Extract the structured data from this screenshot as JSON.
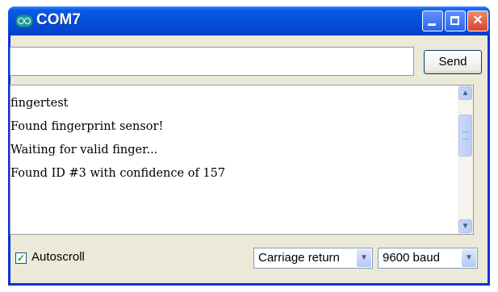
{
  "window": {
    "title": "COM7"
  },
  "icons": {
    "app": "arduino-icon",
    "minimize": "minimize-icon",
    "maximize": "maximize-icon",
    "close": "close-icon"
  },
  "input": {
    "value": "",
    "placeholder": ""
  },
  "send_label": "Send",
  "output_lines": [
    "fingertest",
    "Found fingerprint sensor!",
    "Waiting for valid finger...",
    "Found ID #3 with confidence of 157"
  ],
  "footer": {
    "autoscroll_label": "Autoscroll",
    "autoscroll_checked": true,
    "line_ending": "Carriage return",
    "baud_rate": "9600 baud"
  },
  "colors": {
    "titlebar": "#0552e0",
    "close_button": "#d8452a",
    "checkmark": "#21a121"
  }
}
